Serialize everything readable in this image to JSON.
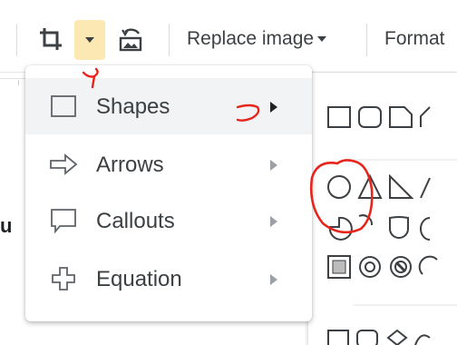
{
  "toolbar": {
    "crop_icon": "crop-icon",
    "crop_dropdown_icon": "chevron-down-icon",
    "reset_icon": "reset-image-icon",
    "replace_image_label": "Replace image",
    "format_label": "Format"
  },
  "document": {
    "partial_char": "u"
  },
  "menu": {
    "items": [
      {
        "label": "Shapes",
        "icon": "square-shape-icon",
        "active": true
      },
      {
        "label": "Arrows",
        "icon": "arrow-shape-icon",
        "active": false
      },
      {
        "label": "Callouts",
        "icon": "callout-shape-icon",
        "active": false
      },
      {
        "label": "Equation",
        "icon": "equation-cross-icon",
        "active": false
      }
    ]
  },
  "annotations": {
    "color": "#e8251c",
    "marks": [
      "handwritten-y-mark",
      "handwritten-arrow-mark",
      "circle-highlight-mark"
    ]
  },
  "colors": {
    "highlight_button": "#fce8b2",
    "menu_active": "#f1f3f4",
    "text": "#3c4043"
  }
}
